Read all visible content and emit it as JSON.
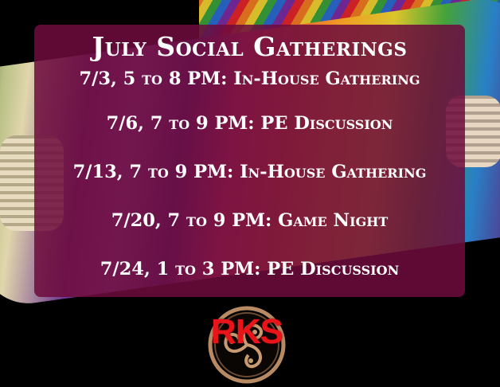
{
  "flyer": {
    "title": "July Social Gatherings",
    "events": [
      "7/3, 5 to 8 PM: In-House Gathering",
      "7/6, 7 to 9 PM: PE Discussion",
      "7/13, 7 to 9 PM: In-House Gathering",
      "7/20, 7 to 9 PM: Game Night",
      "7/24, 1 to 3 PM: PE Discussion"
    ]
  },
  "logo": {
    "text": "RKS",
    "color": "#e8141a"
  },
  "colors": {
    "overlay": "#6e0c3c",
    "background": "#000000",
    "text": "#ffffff"
  }
}
